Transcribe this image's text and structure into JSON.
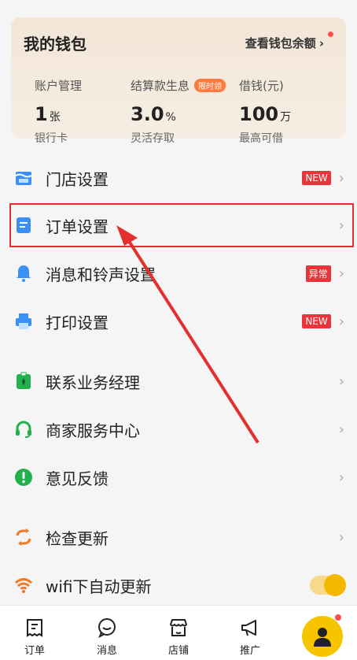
{
  "wallet": {
    "title": "我的钱包",
    "link": "查看钱包余额",
    "link_arrow": "›",
    "stats": [
      {
        "label": "账户管理",
        "value": "1",
        "unit": "张",
        "sub": "银行卡"
      },
      {
        "label": "结算款生息",
        "badge": "限时领",
        "value": "3.0",
        "unit": "%",
        "sub": "灵活存取"
      },
      {
        "label": "借钱(元)",
        "value": "100",
        "unit": "万",
        "sub": "最高可借"
      }
    ]
  },
  "menu": {
    "store_settings": {
      "label": "门店设置",
      "tag": "NEW"
    },
    "order_settings": {
      "label": "订单设置"
    },
    "message_ringtone": {
      "label": "消息和铃声设置",
      "tag": "异常"
    },
    "print_settings": {
      "label": "打印设置",
      "tag": "NEW"
    },
    "contact_manager": {
      "label": "联系业务经理"
    },
    "service_center": {
      "label": "商家服务中心"
    },
    "feedback": {
      "label": "意见反馈"
    },
    "check_update": {
      "label": "检查更新"
    },
    "wifi_auto_update": {
      "label": "wifi下自动更新",
      "enabled": true
    }
  },
  "chevron": "›",
  "tabs": {
    "orders": "订单",
    "messages": "消息",
    "store": "店铺",
    "promote": "推广"
  },
  "colors": {
    "accent_red": "#e3302f",
    "tag_red": "#e8353b",
    "brand_yellow": "#f7c400",
    "wallet_bg": "#f2e6d6"
  }
}
